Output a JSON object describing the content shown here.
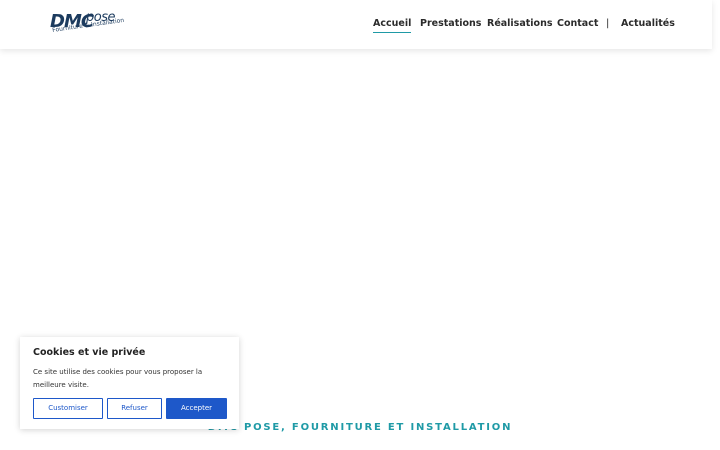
{
  "header": {
    "logo": {
      "main": "DMC",
      "secondary": "pose",
      "tagline": "Fourniture & Installation"
    },
    "nav": [
      {
        "label": "Accueil",
        "active": true
      },
      {
        "label": "Prestations",
        "active": false
      },
      {
        "label": "Réalisations",
        "active": false
      },
      {
        "label": "Contact",
        "active": false
      },
      {
        "label": "Actualités",
        "active": false
      }
    ],
    "separator": "|"
  },
  "hero": {
    "heading": "DMC POSE, FOURNITURE ET INSTALLATION"
  },
  "cookie_banner": {
    "title": "Cookies et vie privée",
    "text": "Ce site utilise des cookies pour vous proposer la meilleure visite.",
    "customize_label": "Customiser",
    "refuse_label": "Refuser",
    "accept_label": "Accepter"
  },
  "colors": {
    "accent": "#1f9aa6",
    "brand": "#1c3b5e",
    "button": "#1e58c9"
  }
}
